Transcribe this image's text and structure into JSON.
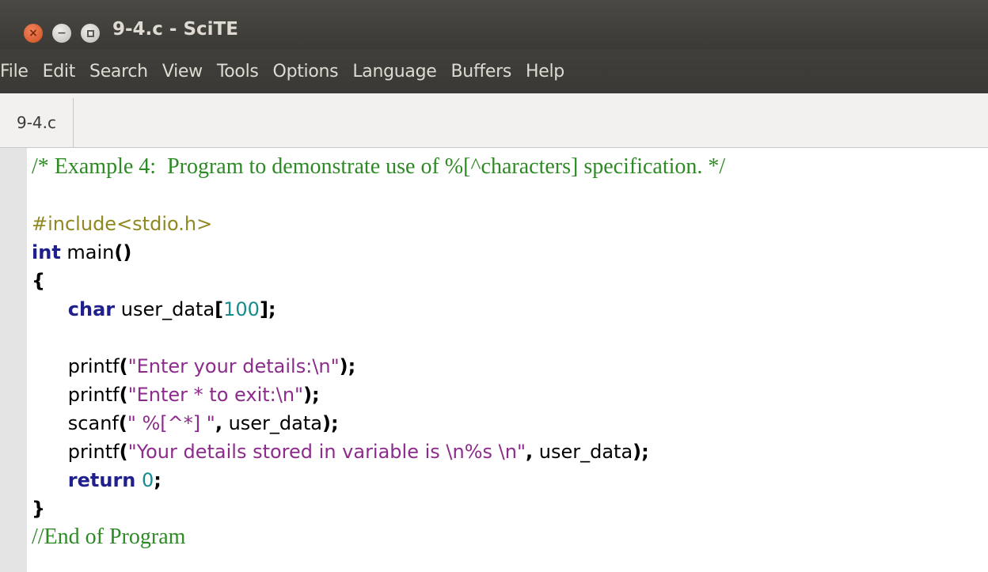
{
  "window": {
    "title": "9-4.c - SciTE",
    "buttons": {
      "close": "×",
      "minimize": "−"
    }
  },
  "menu": [
    "File",
    "Edit",
    "Search",
    "View",
    "Tools",
    "Options",
    "Language",
    "Buffers",
    "Help"
  ],
  "tabs": [
    {
      "label": "9-4.c"
    }
  ],
  "code": {
    "comment_header": "/* Example 4:  Program to demonstrate use of %[^characters] specification. */",
    "include": "#include<stdio.h>",
    "kw_int": "int",
    "main_name": " main",
    "parens": "()",
    "open_brace": "{",
    "kw_char": "char",
    "decl_name": " user_data",
    "lbracket": "[",
    "size": "100",
    "rbracket_semi": "];",
    "printf": "printf",
    "scanf": "scanf",
    "lparen": "(",
    "rparen_semi": ");",
    "str1": "\"Enter your details:\\n\"",
    "str2": "\"Enter * to exit:\\n\"",
    "str3": "\" %[^*] \"",
    "str4": "\"Your details stored in variable is \\n%s \\n\"",
    "comma": ",",
    "arg": " user_data",
    "kw_return": "return",
    "zero": "0",
    "semi": ";",
    "close_brace": "}",
    "comment_footer": "//End of Program"
  }
}
